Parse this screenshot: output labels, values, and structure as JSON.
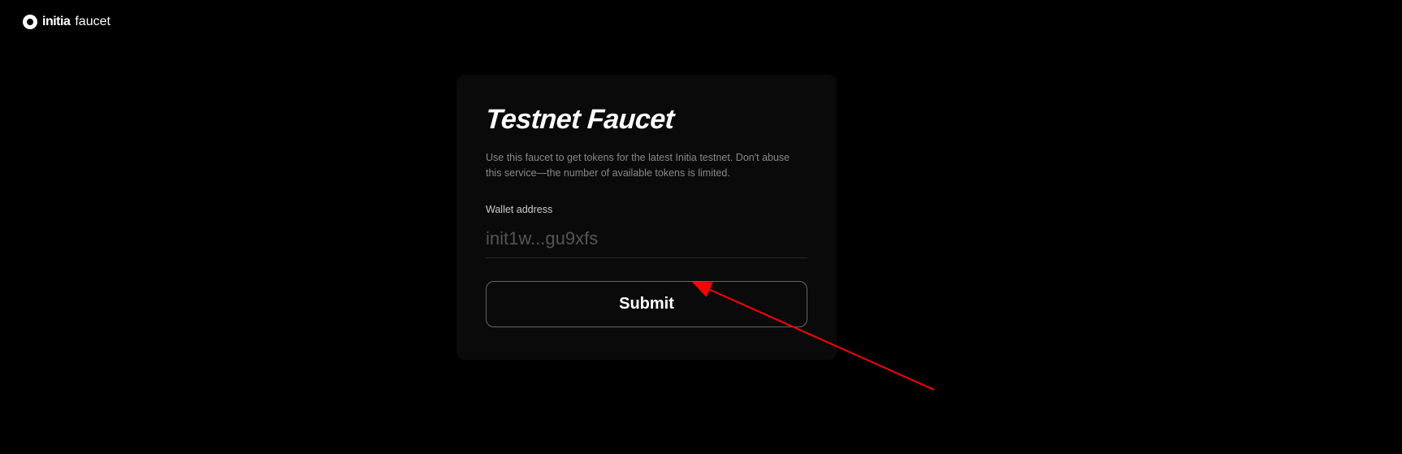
{
  "header": {
    "brand": "initia",
    "suffix": "faucet"
  },
  "card": {
    "title": "Testnet Faucet",
    "description": "Use this faucet to get tokens for the latest Initia testnet. Don't abuse this service—the number of available tokens is limited.",
    "input_label": "Wallet address",
    "input_placeholder": "init1w...gu9xfs",
    "submit_label": "Submit"
  }
}
